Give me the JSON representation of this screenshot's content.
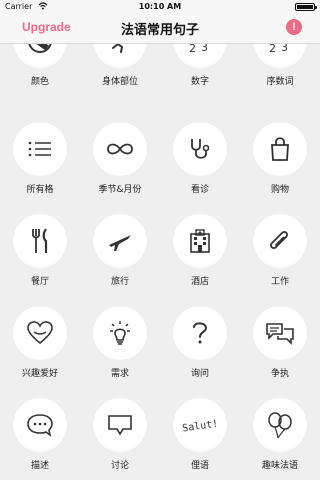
{
  "status_bar": {
    "carrier": "Carrier",
    "time": "10:10 AM"
  },
  "nav": {
    "upgrade_label": "Upgrade",
    "title": "法语常用句子",
    "alert_label": "!"
  },
  "colors": {
    "accent": "#f06a86",
    "background": "#efefef",
    "icon": "#333333"
  },
  "categories": [
    {
      "label": "颜色",
      "icon": "palette-icon"
    },
    {
      "label": "身体部位",
      "icon": "running-person-icon"
    },
    {
      "label": "数字",
      "icon": "numbers-icon"
    },
    {
      "label": "序数词",
      "icon": "ordinal-numbers-icon"
    },
    {
      "label": "所有格",
      "icon": "list-icon"
    },
    {
      "label": "季节&月份",
      "icon": "infinity-icon"
    },
    {
      "label": "看诊",
      "icon": "stethoscope-icon"
    },
    {
      "label": "购物",
      "icon": "shopping-bag-icon"
    },
    {
      "label": "餐厅",
      "icon": "fork-knife-icon"
    },
    {
      "label": "旅行",
      "icon": "airplane-icon"
    },
    {
      "label": "酒店",
      "icon": "hotel-icon"
    },
    {
      "label": "工作",
      "icon": "paperclip-icon"
    },
    {
      "label": "兴趣爱好",
      "icon": "heart-icon"
    },
    {
      "label": "需求",
      "icon": "lightbulb-icon"
    },
    {
      "label": "询问",
      "icon": "question-icon"
    },
    {
      "label": "争执",
      "icon": "chat-bubbles-icon"
    },
    {
      "label": "描述",
      "icon": "speech-bubble-icon"
    },
    {
      "label": "讨论",
      "icon": "message-icon"
    },
    {
      "label": "俚语",
      "icon": "salut-icon",
      "icon_text": "Salut!"
    },
    {
      "label": "趣味法语",
      "icon": "balloons-icon"
    }
  ]
}
